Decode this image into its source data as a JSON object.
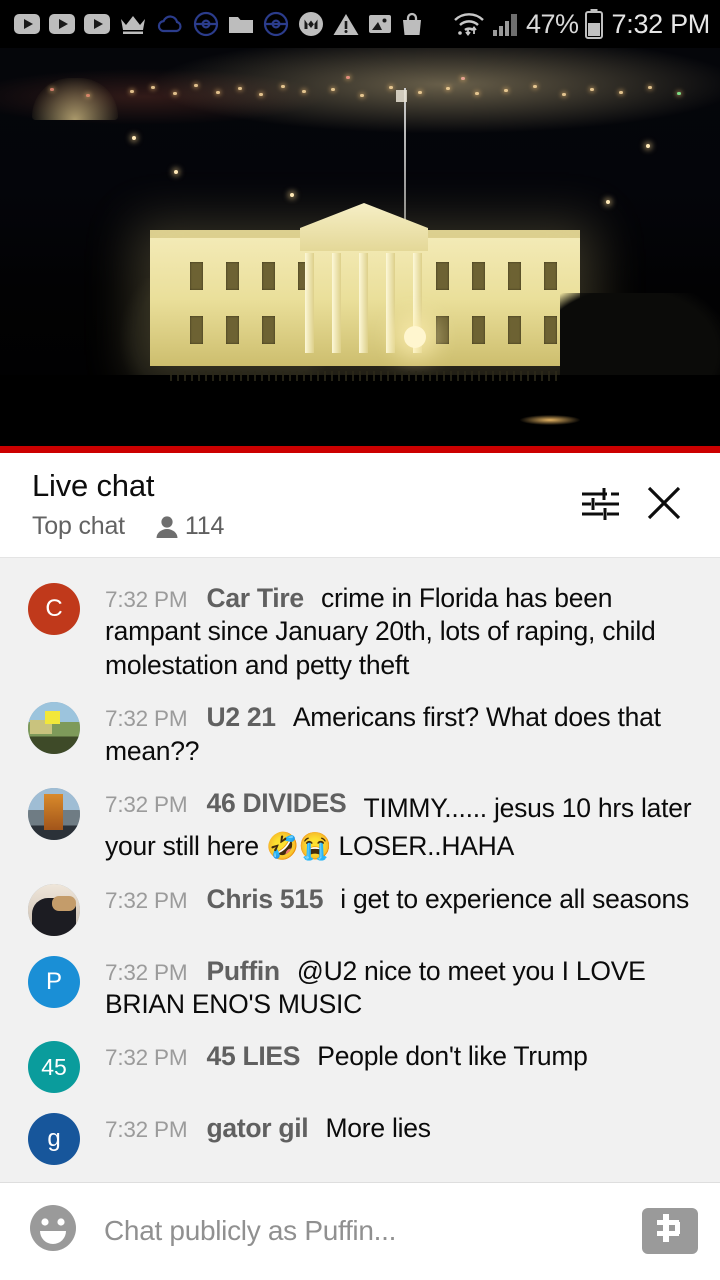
{
  "status_bar": {
    "icons": [
      {
        "name": "youtube-play-icon"
      },
      {
        "name": "youtube-play-icon"
      },
      {
        "name": "youtube-play-icon"
      },
      {
        "name": "crown-icon"
      },
      {
        "name": "cloud-icon"
      },
      {
        "name": "pokeball-icon"
      },
      {
        "name": "folder-icon"
      },
      {
        "name": "pokeball-icon"
      },
      {
        "name": "messenger-m-icon"
      },
      {
        "name": "warning-triangle-icon"
      },
      {
        "name": "photo-icon"
      },
      {
        "name": "shopping-bag-icon"
      }
    ],
    "wifi_icon": "wifi-icon",
    "signal_icon": "cellular-signal-icon",
    "battery_percent": "47%",
    "battery_icon": "battery-icon",
    "time": "7:32 PM"
  },
  "video": {
    "scene_description": "White House at night",
    "progress_color": "#cc0000"
  },
  "chat_header": {
    "title": "Live chat",
    "subtitle": "Top chat",
    "viewer_count": "114",
    "person_icon": "person-icon",
    "settings_icon": "tune-sliders-icon",
    "close_icon": "close-x-icon"
  },
  "messages": [
    {
      "timestamp": "7:32 PM",
      "author": "Car Tire",
      "text": "crime in Florida has been rampant since January 20th, lots of raping, child molestation and petty theft",
      "avatar_type": "letter",
      "avatar_letter": "C",
      "avatar_color": "#c0391b"
    },
    {
      "timestamp": "7:32 PM",
      "author": "U2 21",
      "text": "Americans first? What does that mean??",
      "avatar_type": "photo",
      "avatar_photo": "ph-u2",
      "avatar_color": "#7e9a5a"
    },
    {
      "timestamp": "7:32 PM",
      "author": "46 DIVIDES",
      "text": "TIMMY...... jesus 10 hrs later your still here 🤣😭 LOSER..HAHA",
      "avatar_type": "photo",
      "avatar_photo": "ph-46",
      "avatar_color": "#6f7c84"
    },
    {
      "timestamp": "7:32 PM",
      "author": "Chris 515",
      "text": "i get to experience all seasons",
      "avatar_type": "photo",
      "avatar_photo": "ph-chris",
      "avatar_color": "#c9bcae"
    },
    {
      "timestamp": "7:32 PM",
      "author": "Puffin",
      "text": "@U2 nice to meet you I LOVE BRIAN ENO'S MUSIC",
      "avatar_type": "letter",
      "avatar_letter": "P",
      "avatar_color": "#1a8fd6"
    },
    {
      "timestamp": "7:32 PM",
      "author": "45 LIES",
      "text": "People don't like Trump",
      "avatar_type": "letter",
      "avatar_letter": "45",
      "avatar_color": "#0a9c9c"
    },
    {
      "timestamp": "7:32 PM",
      "author": "gator gil",
      "text": "More lies",
      "avatar_type": "letter",
      "avatar_letter": "g",
      "avatar_color": "#17569b"
    }
  ],
  "input_bar": {
    "emoji_icon": "emoji-smiley-icon",
    "placeholder": "Chat publicly as Puffin...",
    "superchat_icon": "dollar-sign-icon"
  }
}
